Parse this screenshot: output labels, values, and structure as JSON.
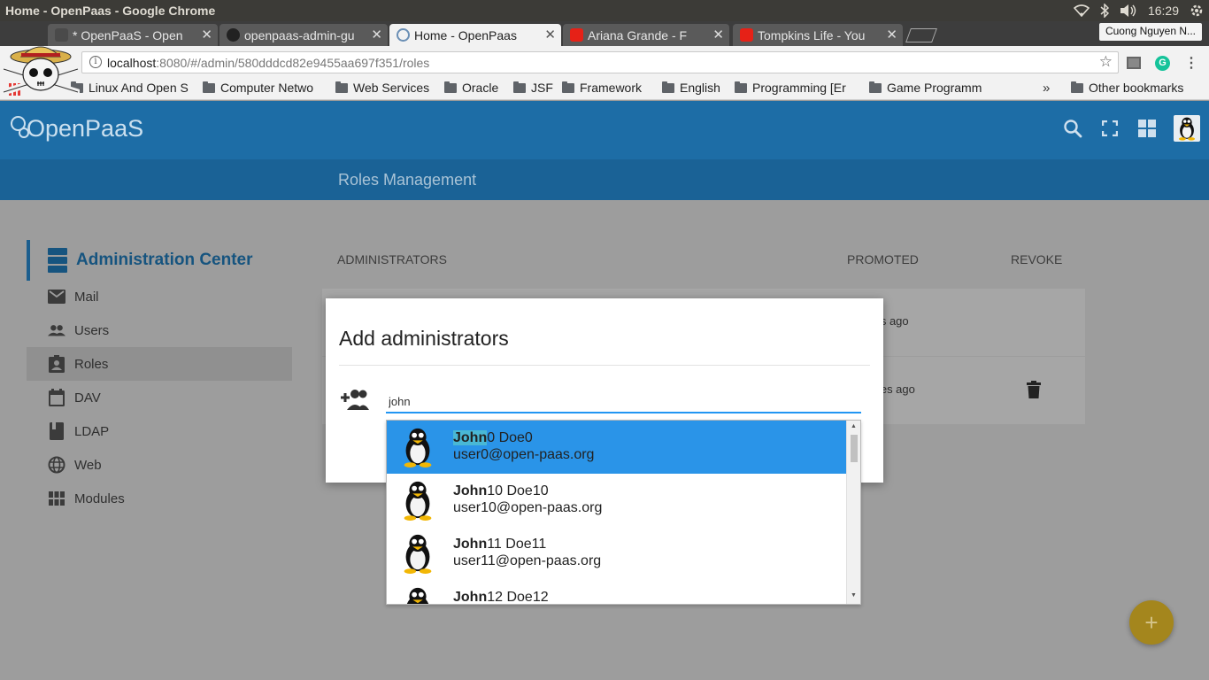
{
  "os": {
    "window_title": "Home - OpenPaas - Google Chrome",
    "clock": "16:29",
    "user_name": "Cuong Nguyen N..."
  },
  "tabs": [
    {
      "label": "* OpenPaaS - Open",
      "icon": "openpaas-tab-icon"
    },
    {
      "label": "openpaas-admin-gu",
      "icon": "github-icon"
    },
    {
      "label": "Home - OpenPaas",
      "icon": "openpaas-tab-icon"
    },
    {
      "label": "Ariana Grande - F",
      "icon": "youtube-icon"
    },
    {
      "label": "Tompkins Life - You",
      "icon": "youtube-icon"
    }
  ],
  "omnibox": {
    "host": "localhost",
    "path": ":8080/#/admin/580dddcd82e9455aa697f351/roles"
  },
  "bookmarks": {
    "items": [
      "Linux And Open S",
      "Computer Netwo",
      "Web Services",
      "Oracle",
      "JSF",
      "Framework",
      "English",
      "Programming [Er",
      "Game Programm"
    ],
    "overflow": "»",
    "other": "Other bookmarks"
  },
  "app": {
    "logo": "OpenPaaS",
    "page_title": "Roles Management",
    "sidebar": {
      "header": "Administration Center",
      "items": [
        {
          "label": "Mail",
          "icon": "mail-icon"
        },
        {
          "label": "Users",
          "icon": "users-icon"
        },
        {
          "label": "Roles",
          "icon": "roles-icon"
        },
        {
          "label": "DAV",
          "icon": "calendar-icon"
        },
        {
          "label": "LDAP",
          "icon": "ldap-icon"
        },
        {
          "label": "Web",
          "icon": "globe-icon"
        },
        {
          "label": "Modules",
          "icon": "modules-icon"
        }
      ],
      "active_index": 2
    },
    "roles": {
      "columns": {
        "administrators": "ADMINISTRATORS",
        "promoted": "PROMOTED",
        "revoke": "REVOKE"
      },
      "rows": [
        {
          "promoted": "ths ago"
        },
        {
          "promoted": "utes ago"
        }
      ]
    },
    "fab_label": "+"
  },
  "modal": {
    "title": "Add administrators",
    "search_value": "john",
    "results": [
      {
        "match": "John",
        "rest": "0 Doe0",
        "email": "user0@open-paas.org"
      },
      {
        "match": "John",
        "rest": "10 Doe10",
        "email": "user10@open-paas.org"
      },
      {
        "match": "John",
        "rest": "11 Doe11",
        "email": "user11@open-paas.org"
      },
      {
        "match": "John",
        "rest": "12 Doe12",
        "email": ""
      }
    ],
    "selected_index": 0
  },
  "colors": {
    "header": "#1d6da6",
    "subheader": "#1a6296",
    "selected_item": "#2a94e8",
    "input_underline": "#2196f3",
    "fab": "#a4861d"
  }
}
